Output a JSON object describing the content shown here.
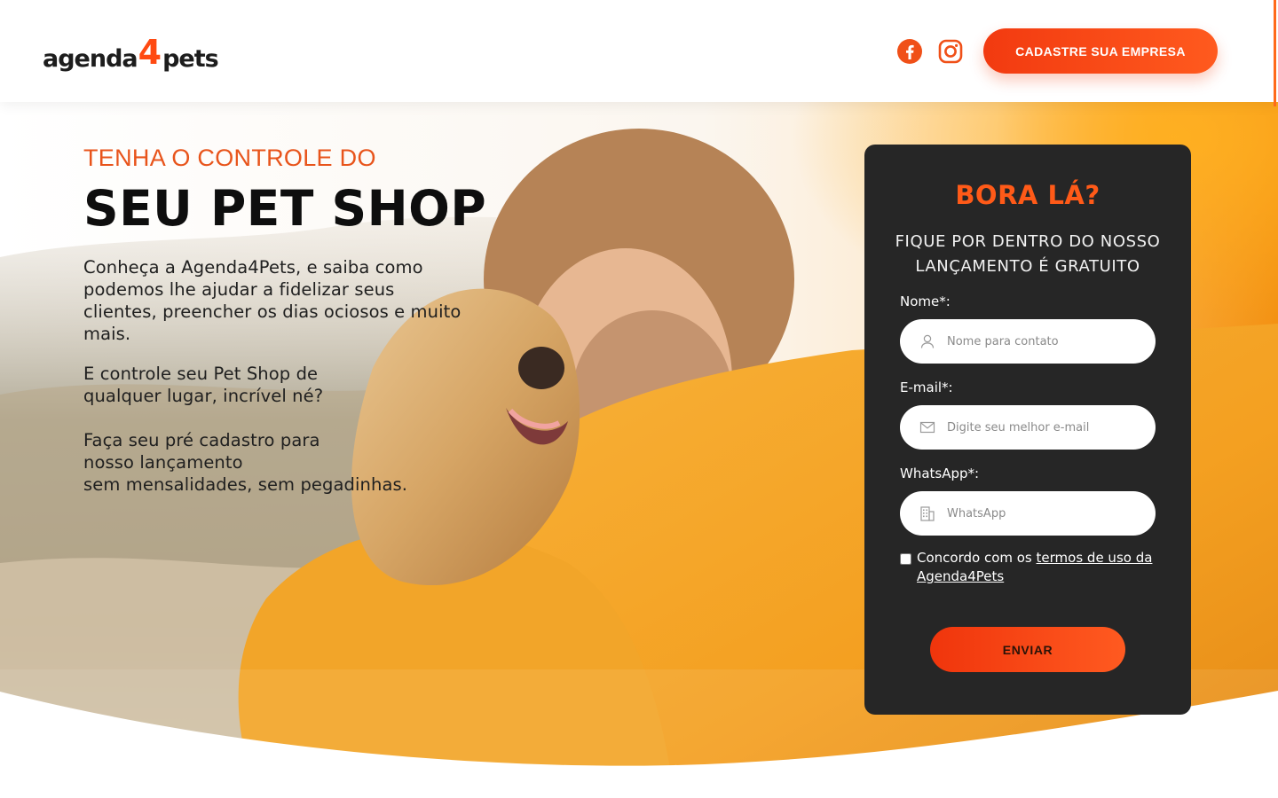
{
  "header": {
    "logo": {
      "part1": "agenda",
      "part2": "4",
      "part3": "pets"
    },
    "social": {
      "facebook_icon": "facebook-icon",
      "instagram_icon": "instagram-icon"
    },
    "cta_label": "CADASTRE SUA EMPRESA"
  },
  "hero": {
    "kicker": "TENHA O CONTROLE DO",
    "headline": "SEU PET SHOP",
    "paragraph_1": "Conheça a Agenda4Pets, e saiba como podemos lhe ajudar a fidelizar seus clientes, preencher os dias ociosos e muito mais.",
    "paragraph_2": "E controle seu Pet Shop de qualquer lugar, incrível né?",
    "paragraph_3_line1": "Faça seu pré cadastro para",
    "paragraph_3_line2": "nosso lançamento",
    "paragraph_3_line3": "sem mensalidades, sem pegadinhas."
  },
  "form": {
    "title": "BORA LÁ?",
    "subtitle": "FIQUE POR DENTRO DO NOSSO LANÇAMENTO É GRATUITO",
    "name_label": "Nome*:",
    "name_placeholder": "Nome para contato",
    "name_value": "",
    "email_label": "E-mail*:",
    "email_placeholder": "Digite seu melhor e-mail",
    "email_value": "",
    "whatsapp_label": "WhatsApp*:",
    "whatsapp_placeholder": "WhatsApp",
    "whatsapp_value": "",
    "terms_prefix": "Concordo com os ",
    "terms_link": "termos de uso da Agenda4Pets",
    "terms_checked": false,
    "submit_label": "ENVIAR"
  },
  "colors": {
    "accent": "#ff5a18",
    "card_bg": "#262626",
    "hoodie": "#f6a623"
  }
}
